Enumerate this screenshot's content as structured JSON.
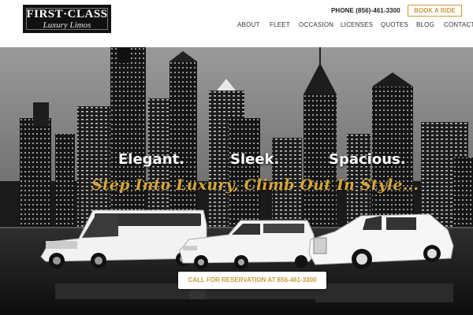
{
  "logo": {
    "line1": "FIRST·CLASS",
    "line2": "Luxury Limos"
  },
  "header": {
    "phone": "PHONE (856)-461-3300",
    "book_button": "BOOK A RIDE",
    "nav": [
      "ABOUT",
      "FLEET",
      "OCCASION",
      "LICENSES",
      "QUOTES",
      "BLOG",
      "CONTACT"
    ]
  },
  "hero": {
    "tag1": "Elegant.",
    "tag2": "Sleek.",
    "tag3": "Spacious.",
    "slogan": "Step Into Luxury, Climb Out In Style...",
    "cta": "CALL FOR RESERVATION AT 856-461-3300"
  },
  "colors": {
    "accent": "#c99a3b",
    "slogan_gold": "#d7a63a"
  }
}
